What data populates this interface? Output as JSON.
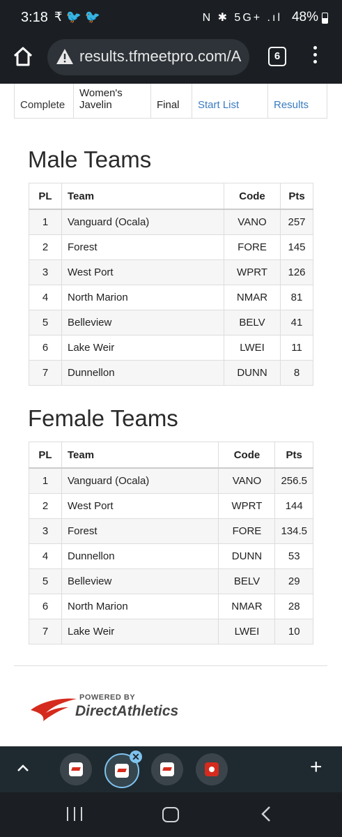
{
  "status_bar": {
    "time": "3:18",
    "left_icons": "₹ 🐦 🐦",
    "right_icons": "N ✱ 5G+ .ıl",
    "battery": "48%"
  },
  "browser": {
    "url": "results.tfmeetpro.com/A",
    "tab_count": "6"
  },
  "previous_row": {
    "status": "Complete",
    "event": "Women's Javelin",
    "round": "Final",
    "start_list": "Start List",
    "results": "Results"
  },
  "male_teams": {
    "title": "Male Teams",
    "headers": {
      "pl": "PL",
      "team": "Team",
      "code": "Code",
      "pts": "Pts"
    },
    "rows": [
      {
        "pl": "1",
        "team": "Vanguard (Ocala)",
        "code": "VANO",
        "pts": "257"
      },
      {
        "pl": "2",
        "team": "Forest",
        "code": "FORE",
        "pts": "145"
      },
      {
        "pl": "3",
        "team": "West Port",
        "code": "WPRT",
        "pts": "126"
      },
      {
        "pl": "4",
        "team": "North Marion",
        "code": "NMAR",
        "pts": "81"
      },
      {
        "pl": "5",
        "team": "Belleview",
        "code": "BELV",
        "pts": "41"
      },
      {
        "pl": "6",
        "team": "Lake Weir",
        "code": "LWEI",
        "pts": "11"
      },
      {
        "pl": "7",
        "team": "Dunnellon",
        "code": "DUNN",
        "pts": "8"
      }
    ]
  },
  "female_teams": {
    "title": "Female Teams",
    "headers": {
      "pl": "PL",
      "team": "Team",
      "code": "Code",
      "pts": "Pts"
    },
    "rows": [
      {
        "pl": "1",
        "team": "Vanguard (Ocala)",
        "code": "VANO",
        "pts": "256.5"
      },
      {
        "pl": "2",
        "team": "West Port",
        "code": "WPRT",
        "pts": "144"
      },
      {
        "pl": "3",
        "team": "Forest",
        "code": "FORE",
        "pts": "134.5"
      },
      {
        "pl": "4",
        "team": "Dunnellon",
        "code": "DUNN",
        "pts": "53"
      },
      {
        "pl": "5",
        "team": "Belleview",
        "code": "BELV",
        "pts": "29"
      },
      {
        "pl": "6",
        "team": "North Marion",
        "code": "NMAR",
        "pts": "28"
      },
      {
        "pl": "7",
        "team": "Lake Weir",
        "code": "LWEI",
        "pts": "10"
      }
    ]
  },
  "footer": {
    "powered_by": "POWERED BY",
    "brand": "DirectAthletics"
  },
  "tab_strip": {
    "plus": "+",
    "close": "✕"
  },
  "colors": {
    "link": "#3a7bbf",
    "brand_red": "#d52b1e",
    "tab_selected": "#7ec3ef"
  }
}
